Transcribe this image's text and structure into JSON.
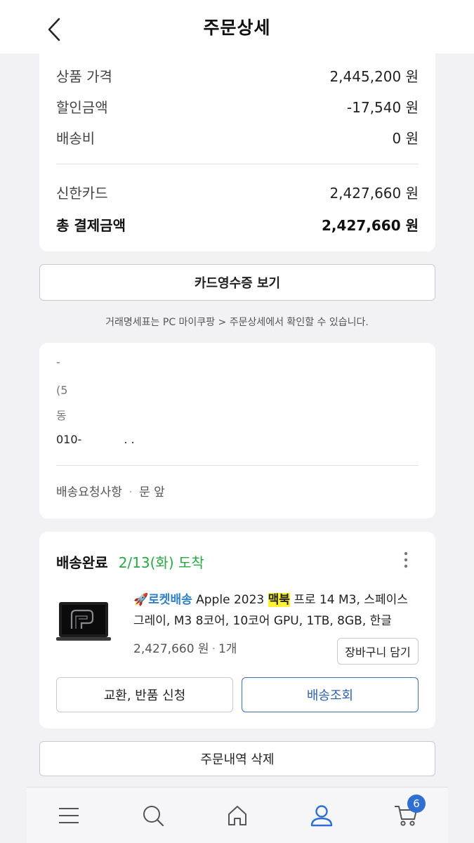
{
  "header": {
    "title": "주문상세"
  },
  "payment": {
    "rows": [
      {
        "label": "상품 가격",
        "value": "2,445,200 원"
      },
      {
        "label": "할인금액",
        "value": "-17,540 원"
      },
      {
        "label": "배송비",
        "value": "0 원"
      }
    ],
    "card_label": "신한카드",
    "card_value": "2,427,660 원",
    "total_label": "총 결제금액",
    "total_value": "2,427,660 원"
  },
  "receipt_button": "카드영수증 보기",
  "receipt_note": "거래명세표는 PC 마이쿠팡 > 주문상세에서 확인할 수 있습니다.",
  "address": {
    "line1": "-",
    "line2": "(5",
    "line3": "동",
    "phone": "010-",
    "phone_tail": ". .",
    "request_label": "배송요청사항",
    "request_value": "문 앞"
  },
  "delivery": {
    "status": "배송완료",
    "date": "2/13(화) 도착",
    "rocket_label": "🚀로켓배송",
    "product_pre": "Apple 2023 ",
    "product_highlight": "맥북",
    "product_post": " 프로 14 M3, 스페이스 그레이, M3 8코어, 10코어 GPU, 1TB, 8GB, 한글",
    "price": "2,427,660 원",
    "qty": "1개",
    "cart_button": "장바구니 담기",
    "return_button": "교환, 반품 신청",
    "track_button": "배송조회"
  },
  "delete_button": "주문내역 삭제",
  "nav": {
    "items": [
      "menu-icon",
      "search-icon",
      "home-icon",
      "user-icon",
      "cart-icon"
    ],
    "cart_badge": "6"
  }
}
